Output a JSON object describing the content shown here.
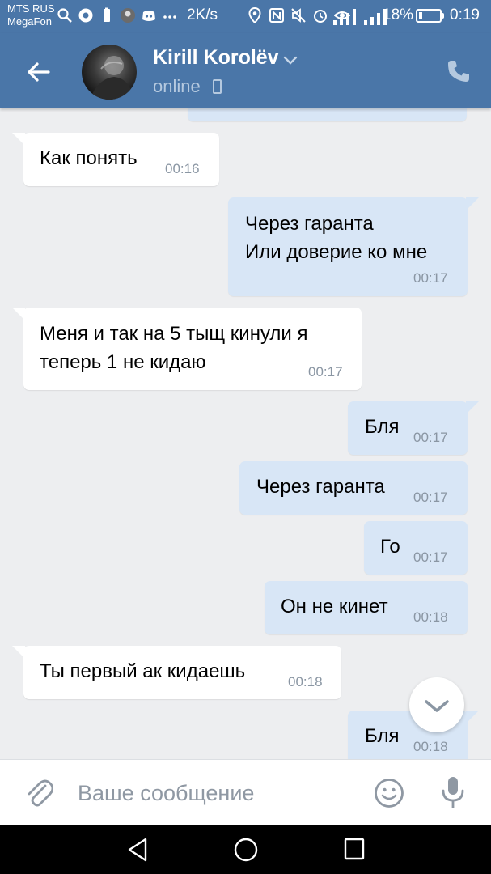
{
  "status_bar": {
    "carrier_line1": "MTS RUS",
    "carrier_line2": "MegaFon",
    "left_icons": [
      "search-icon",
      "chrome-icon",
      "phone-battery-icon",
      "avatar-notification-icon",
      "discord-icon",
      "more-icon"
    ],
    "speed": "2K/s",
    "mid_icons": [
      "location-icon",
      "nfc-icon",
      "mute-icon",
      "alarm-icon",
      "eye-icon"
    ],
    "battery_percent": "18%",
    "battery_level": 0.18,
    "time": "0:19"
  },
  "header": {
    "contact_name": "Kirill Korolëv",
    "presence": "online",
    "accent_color": "#4a76a8"
  },
  "messages": [
    {
      "dir": "in",
      "text": "Как понять",
      "time": "00:16"
    },
    {
      "dir": "out",
      "text": "Через гаранта\nИли доверие ко мне",
      "time": "00:17"
    },
    {
      "dir": "in",
      "text": "Меня и так на 5 тыщ кинули я\nтеперь 1 не кидаю",
      "time": "00:17"
    },
    {
      "dir": "out",
      "text": "Бля",
      "time": "00:17"
    },
    {
      "dir": "out",
      "text": "Через гаранта",
      "time": "00:17"
    },
    {
      "dir": "out",
      "text": "Го",
      "time": "00:17"
    },
    {
      "dir": "out",
      "text": "Он не кинет",
      "time": "00:18"
    },
    {
      "dir": "in",
      "text": "Ты первый ак кидаешь",
      "time": "00:18"
    },
    {
      "dir": "out",
      "text": "Бля",
      "time": "00:18"
    }
  ],
  "composer": {
    "placeholder": "Ваше сообщение"
  },
  "colors": {
    "incoming_bubble": "#ffffff",
    "outgoing_bubble": "#d8e6f6",
    "chat_background": "#edeef0"
  }
}
